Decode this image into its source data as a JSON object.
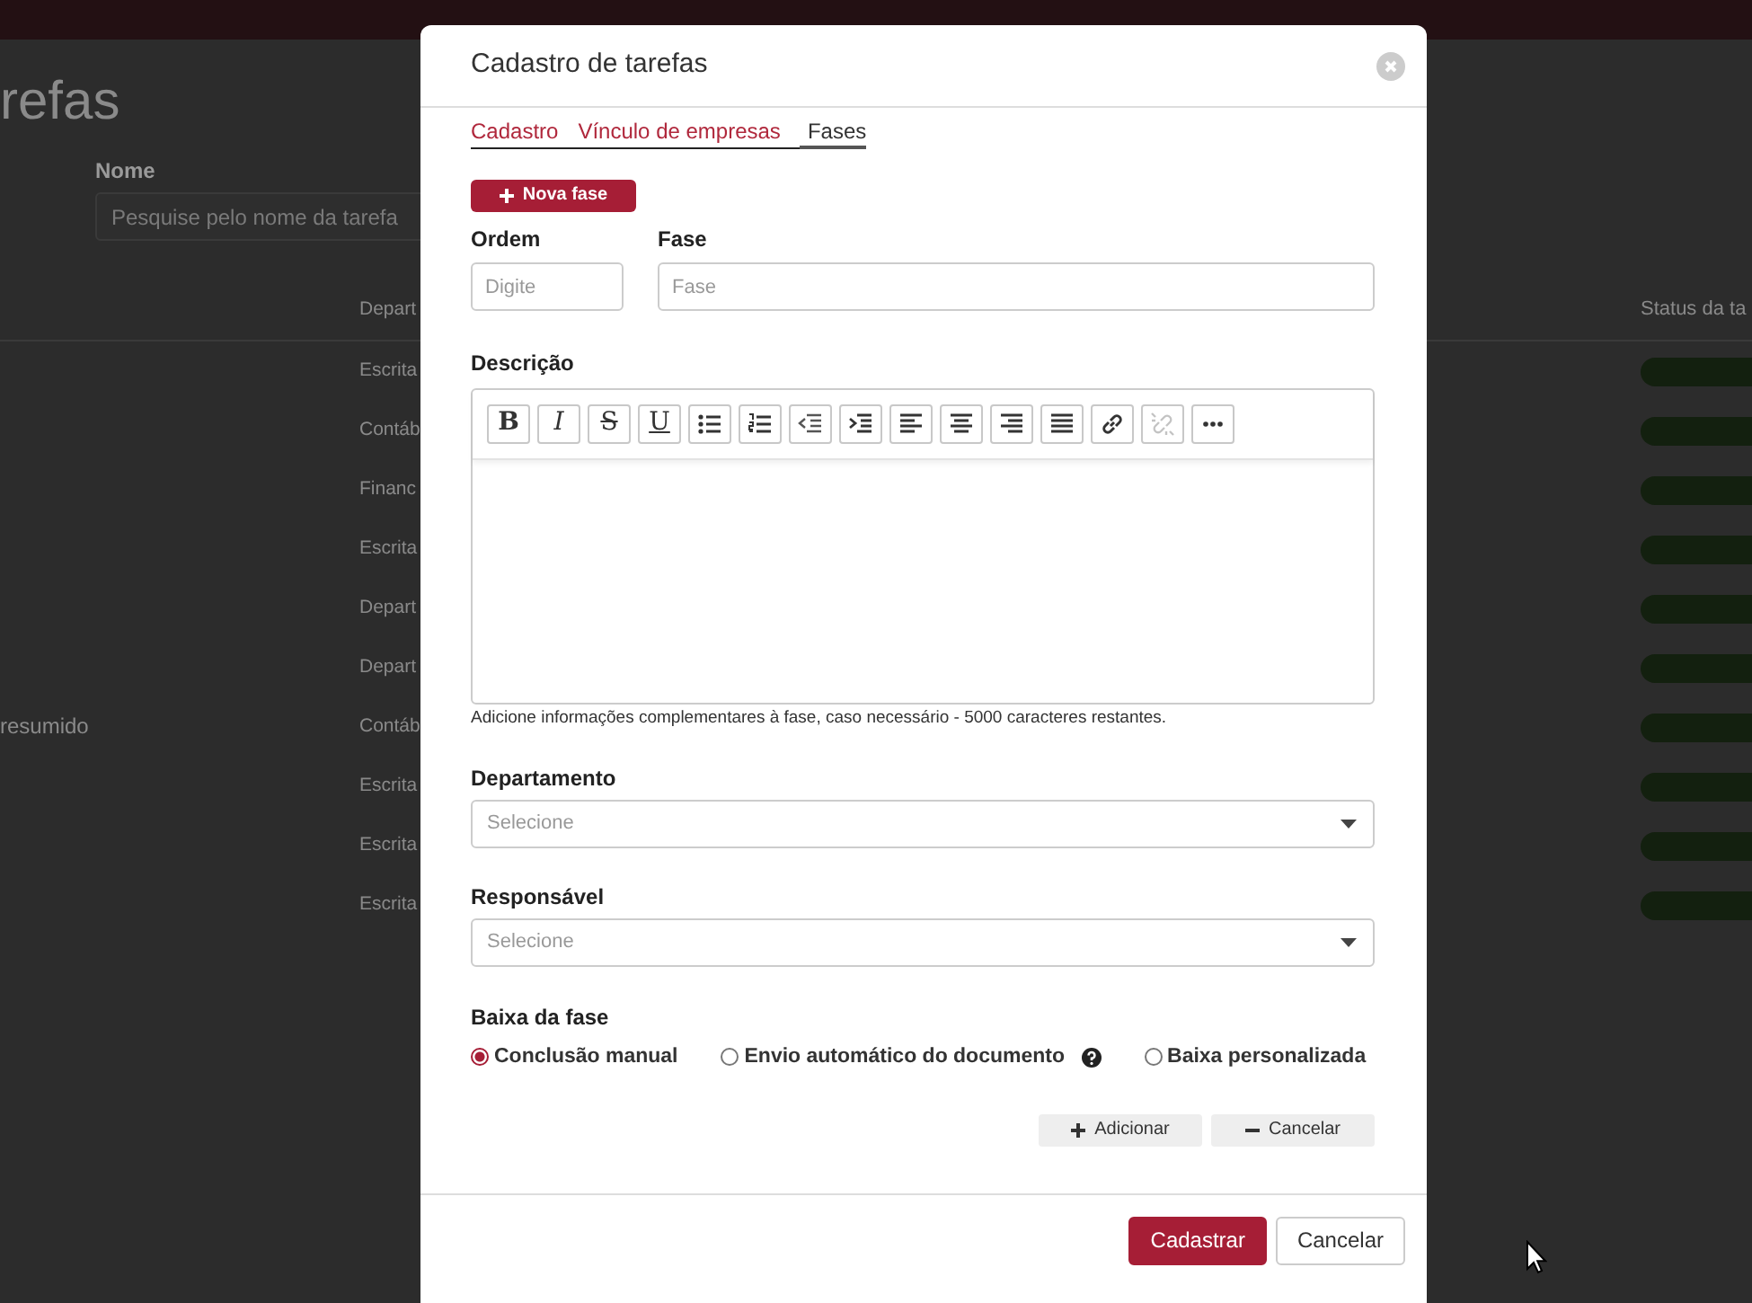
{
  "background_page": {
    "title": "refas",
    "search": {
      "label": "Nome",
      "placeholder": "Pesquise pelo nome da tarefa"
    },
    "table": {
      "columns": [
        "Depart",
        "Status da ta"
      ],
      "rows": [
        {
          "department": "Escrita"
        },
        {
          "department": "Contáb"
        },
        {
          "department": "Financ"
        },
        {
          "department": "Escrita"
        },
        {
          "department": "Depart"
        },
        {
          "department": "Depart"
        },
        {
          "column_1": "resumido",
          "department": "Contáb"
        },
        {
          "department": "Escrita"
        },
        {
          "department": "Escrita"
        },
        {
          "department": "Escrita"
        }
      ]
    }
  },
  "modal": {
    "title": "Cadastro de tarefas",
    "tabs": [
      {
        "label": "Cadastro",
        "selected": false
      },
      {
        "label": "Vínculo de empresas",
        "selected": false
      },
      {
        "label": "Fases",
        "selected": true
      }
    ],
    "new_phase_button": "Nova fase",
    "order": {
      "label": "Ordem",
      "placeholder": "Digite"
    },
    "phase": {
      "label": "Fase",
      "placeholder": "Fase"
    },
    "description": {
      "label": "Descrição",
      "toolbar": [
        {
          "kind": "bold",
          "label": "B",
          "disabled": false
        },
        {
          "kind": "italic",
          "label": "I",
          "disabled": false
        },
        {
          "kind": "strike",
          "label": "S",
          "disabled": false
        },
        {
          "kind": "underline",
          "label": "U",
          "disabled": false
        },
        {
          "kind": "bullets",
          "disabled": false
        },
        {
          "kind": "numbers",
          "disabled": false
        },
        {
          "kind": "outdent",
          "disabled": false
        },
        {
          "kind": "indent",
          "disabled": false
        },
        {
          "kind": "align-left",
          "disabled": false
        },
        {
          "kind": "align-center",
          "disabled": false
        },
        {
          "kind": "align-right",
          "disabled": false
        },
        {
          "kind": "justify",
          "disabled": false
        },
        {
          "kind": "link",
          "disabled": false
        },
        {
          "kind": "unlink",
          "disabled": true
        },
        {
          "kind": "more",
          "disabled": false
        }
      ],
      "help": "Adicione informações complementares à fase, caso necessário - 5000 caracteres restantes."
    },
    "department": {
      "label": "Departamento",
      "placeholder": "Selecione"
    },
    "responsible": {
      "label": "Responsável",
      "placeholder": "Selecione"
    },
    "completion": {
      "label": "Baixa da fase",
      "options": [
        {
          "label": "Conclusão manual",
          "selected": true,
          "help_icon": false
        },
        {
          "label": "Envio automático do documento",
          "selected": false,
          "help_icon": true
        },
        {
          "label": "Baixa personalizada",
          "selected": false,
          "help_icon": false
        }
      ]
    },
    "row_actions": [
      {
        "kind": "add",
        "label": "Adicionar"
      },
      {
        "kind": "remove",
        "label": "Cancelar"
      }
    ],
    "footer_buttons": [
      {
        "kind": "primary",
        "label": "Cadastrar"
      },
      {
        "kind": "secondary",
        "label": "Cancelar"
      }
    ]
  }
}
